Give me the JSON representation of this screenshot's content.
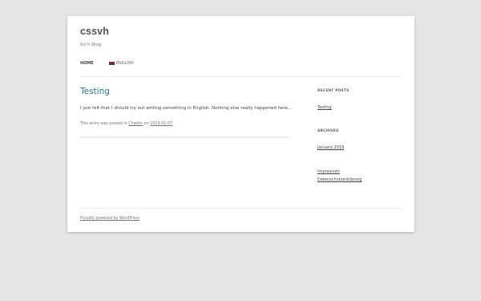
{
  "site": {
    "title": "cssvh",
    "description": "Sci'n Blog"
  },
  "nav": {
    "items": [
      {
        "label": "Home"
      },
      {
        "label": "English"
      }
    ]
  },
  "post": {
    "title": "Testing",
    "excerpt": "I just felt that I should try out writing something in English. Nothing else really happened here...",
    "meta_prefix": "This entry was posted in",
    "category": "Chatter",
    "meta_on": "on",
    "date": "2019-01-07",
    "meta_suffix": "."
  },
  "sidebar": {
    "recent_posts_title": "Recent Posts",
    "recent_posts": [
      "Testing"
    ],
    "archives_title": "Archives",
    "archives": [
      "January 2019"
    ],
    "pages": [
      "Impressum",
      "Datenschutzerklärung"
    ]
  },
  "footer": {
    "credit": "Proudly powered by WordPress"
  },
  "colors": {
    "link": "#21759b",
    "background": "#e6e6e6",
    "page": "#ffffff"
  }
}
